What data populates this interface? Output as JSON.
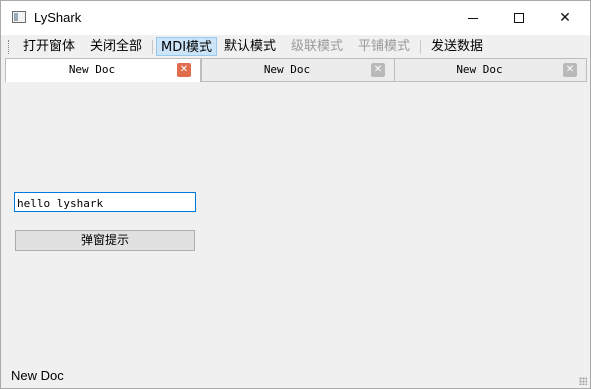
{
  "window": {
    "title": "LyShark",
    "controls": {
      "minimize": "—",
      "maximize": "☐",
      "close": "✕"
    }
  },
  "toolbar": {
    "items": [
      {
        "label": "打开窗体",
        "state": "normal"
      },
      {
        "label": "关闭全部",
        "state": "normal"
      },
      {
        "label": "MDI模式",
        "state": "active"
      },
      {
        "label": "默认模式",
        "state": "normal"
      },
      {
        "label": "级联模式",
        "state": "disabled"
      },
      {
        "label": "平铺模式",
        "state": "disabled"
      },
      {
        "label": "发送数据",
        "state": "normal"
      }
    ]
  },
  "tabs": [
    {
      "label": "New Doc",
      "current": true,
      "close_icon": "✕"
    },
    {
      "label": "New Doc",
      "current": false,
      "close_icon": "✕"
    },
    {
      "label": "New Doc",
      "current": false,
      "close_icon": "✕"
    }
  ],
  "form": {
    "input_value": "hello lyshark",
    "button_label": "弹窗提示"
  },
  "status": {
    "text": "New Doc"
  },
  "colors": {
    "accent": "#0078d7",
    "active_tool_bg": "#cce4f7",
    "tab_close_active": "#e06c4b"
  }
}
